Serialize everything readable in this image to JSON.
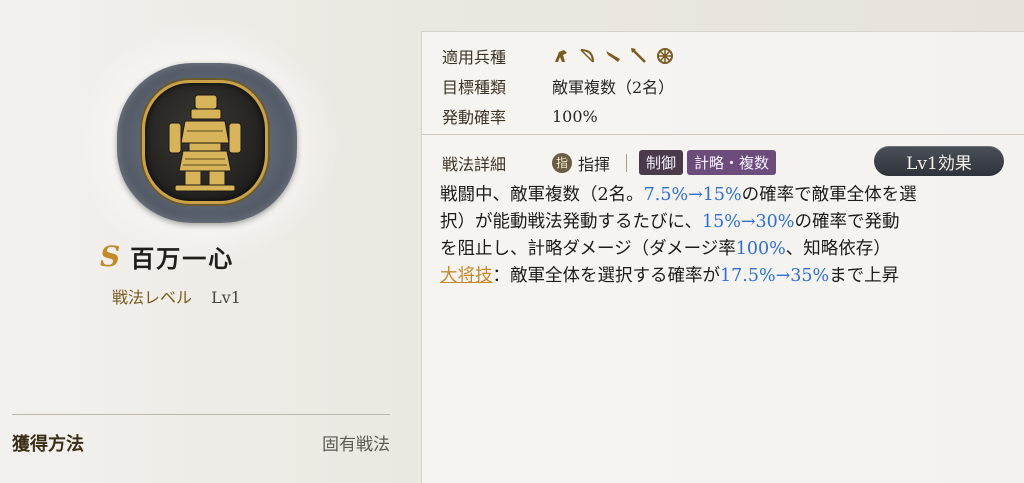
{
  "skill": {
    "rank": "S",
    "name": "百万一心",
    "level_label": "戦法レベル",
    "level_value": "Lv1"
  },
  "acquisition": {
    "label": "獲得方法",
    "value": "固有戦法"
  },
  "info": {
    "troop_label": "適用兵種",
    "troop_icons": [
      "cavalry-icon",
      "bow-icon",
      "gun-icon",
      "spear-icon",
      "wheel-icon"
    ],
    "target_label": "目標種類",
    "target_value": "敵軍複数（2名）",
    "rate_label": "発動確率",
    "rate_value": "100%"
  },
  "detail": {
    "label": "戦法詳細",
    "type_icon": "指",
    "type_value": "指揮",
    "tags": [
      "制御",
      "計略・複数"
    ],
    "effect_button": "Lv1効果",
    "line1_a": "戦闘中、敵軍複数（2名。",
    "line1_num": "7.5%→15%",
    "line1_b": "の確率で敵軍全体を選",
    "line2_a": "択）が能動戦法発動するたびに、",
    "line2_num": "15%→30%",
    "line2_b": "の確率で発動",
    "line3_a": "を阻止し、計略ダメージ（ダメージ率",
    "line3_num": "100%",
    "line3_b": "、知略依存）",
    "line4_link": "大将技",
    "line4_a": "：敵軍全体を選択する確率が",
    "line4_num": "17.5%→35%",
    "line4_b": "まで上昇"
  },
  "colors": {
    "accent_gold": "#c28a27",
    "number_blue": "#2f6fd1",
    "tag_control": "#4b3a4a",
    "tag_strategy": "#6c4c7a"
  }
}
